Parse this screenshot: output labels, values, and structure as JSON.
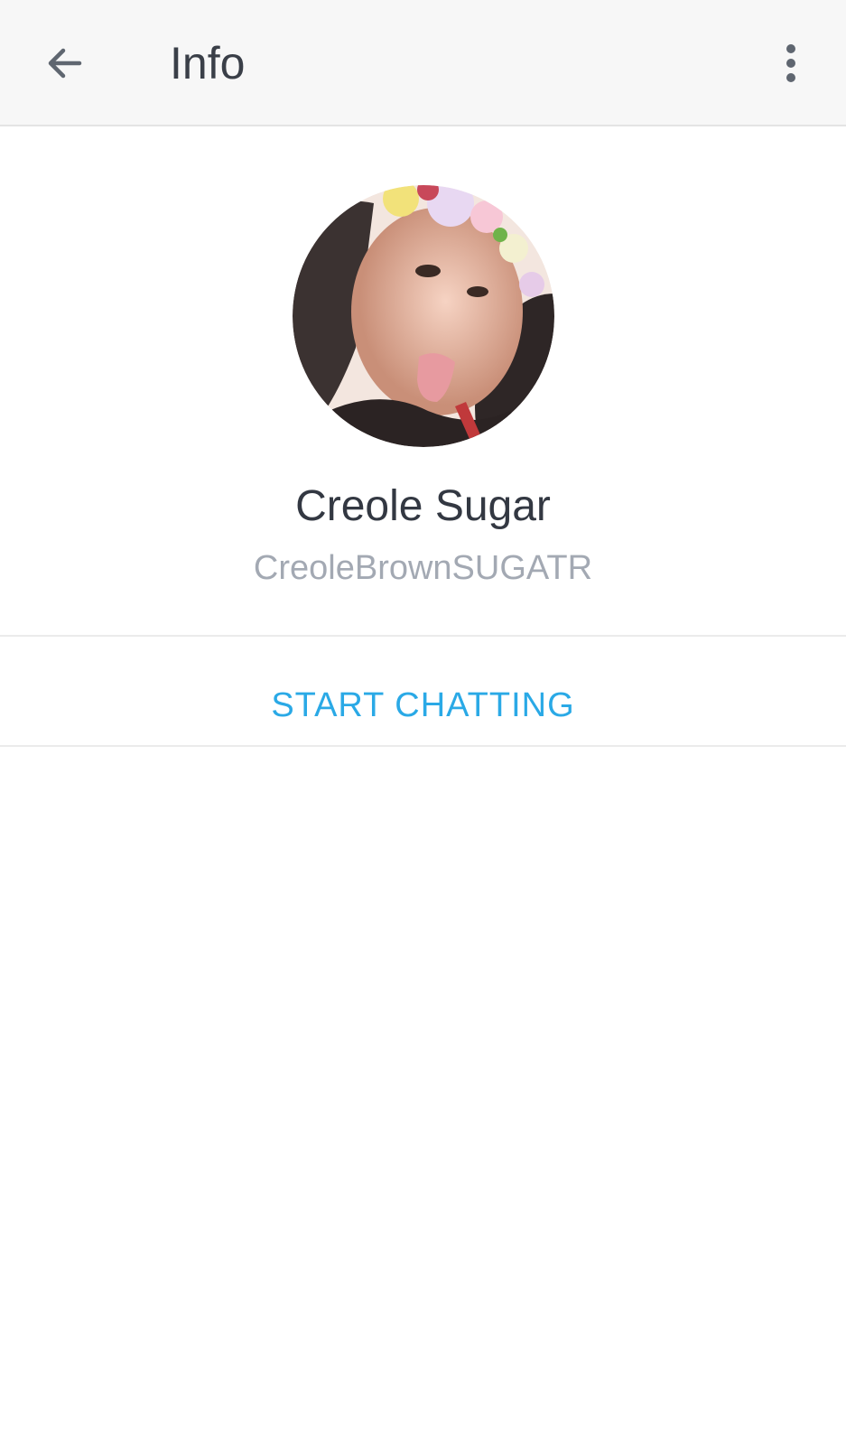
{
  "header": {
    "title": "Info",
    "back_icon": "arrow-left-icon",
    "menu_icon": "more-vertical-icon"
  },
  "profile": {
    "display_name": "Creole Sugar",
    "username": "CreoleBrownSUGATR",
    "avatar_icon": "profile-photo"
  },
  "actions": {
    "start_chatting_label": "START CHATTING"
  },
  "colors": {
    "accent": "#2aa9e6",
    "toolbar_bg": "#f7f7f7",
    "title_text": "#3a3f48",
    "secondary_text": "#a3a9b3"
  }
}
